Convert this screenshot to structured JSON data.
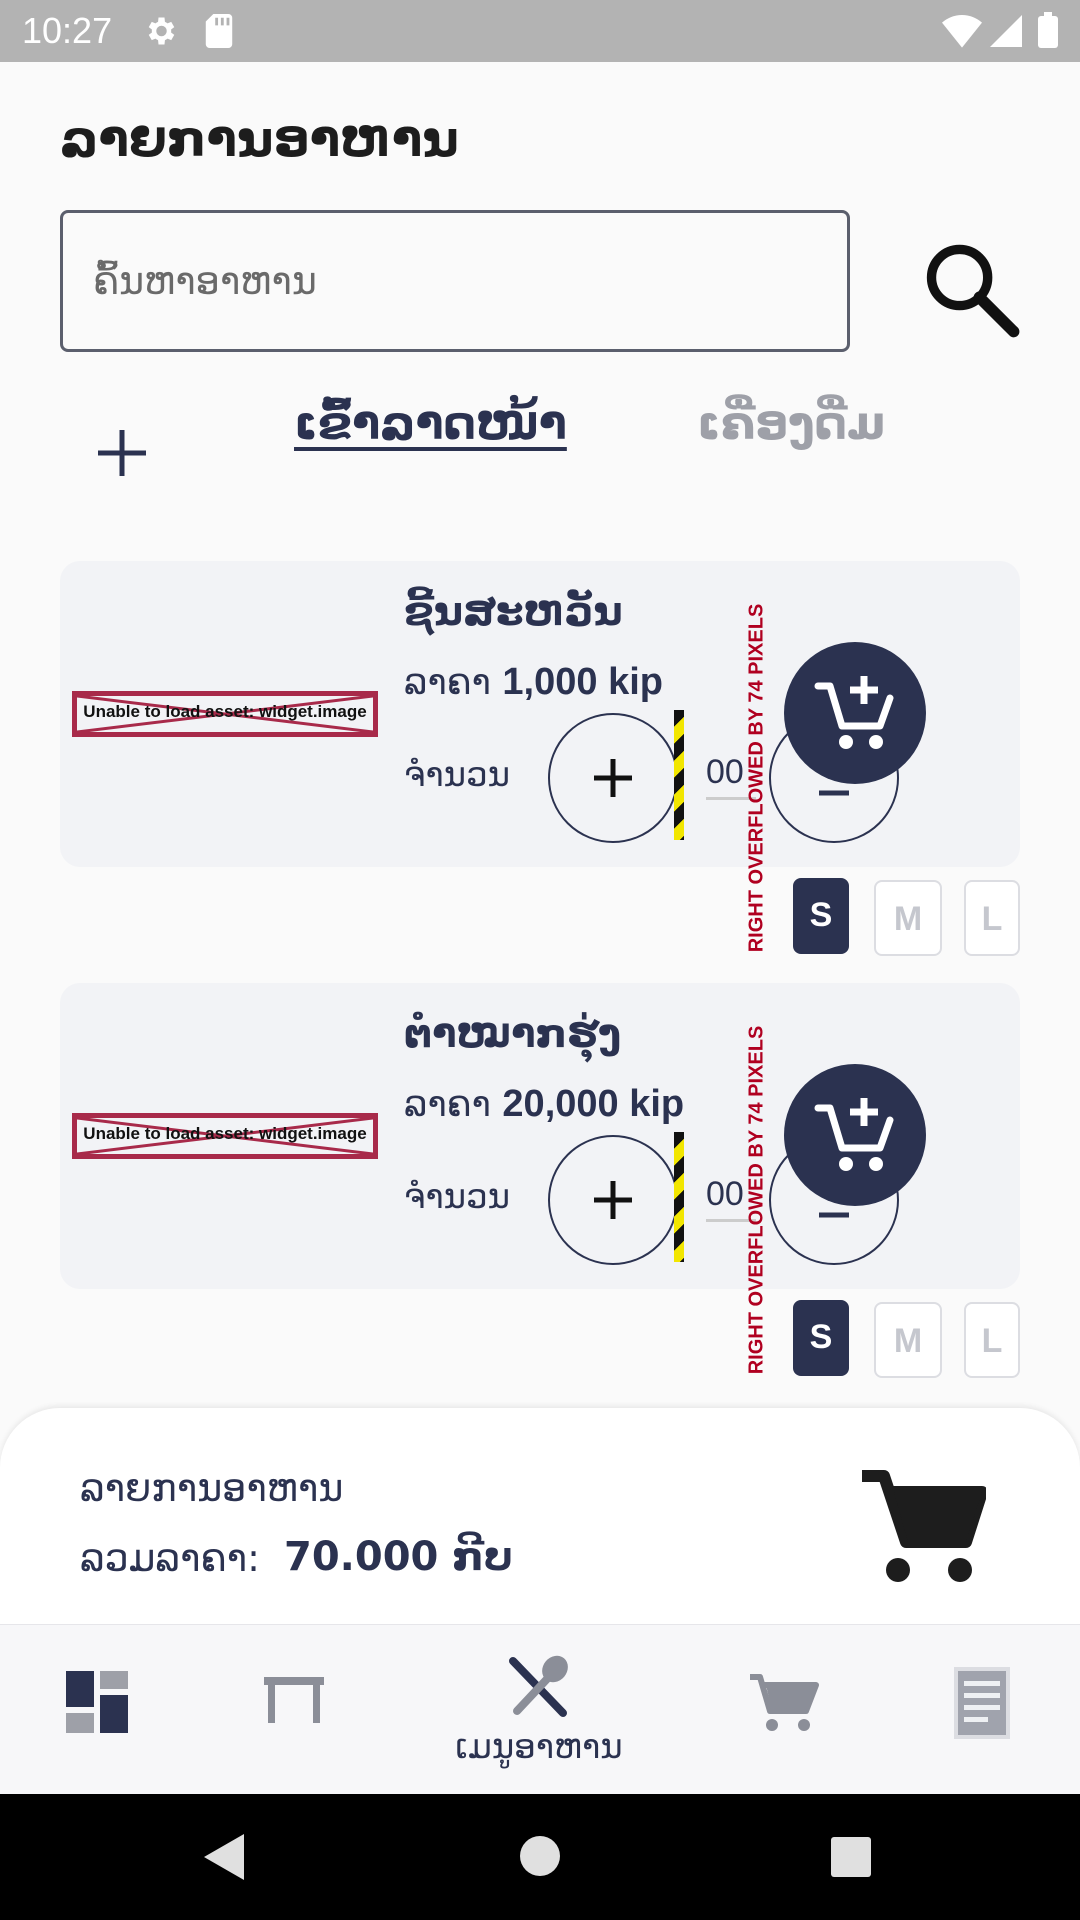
{
  "status_bar": {
    "time": "10:27"
  },
  "header": {
    "title": "ລາຍການອາຫານ"
  },
  "search": {
    "placeholder": "ຄົ້ນຫາອາຫານ"
  },
  "tabs": [
    {
      "label": "ເຂົ້າລາດໜ້າ",
      "active": true
    },
    {
      "label": "ເຄື່ອງດື່ມ",
      "active": false
    }
  ],
  "items": [
    {
      "image_error": "Unable to load asset: widget.image",
      "name": "ຊີ້ນສະຫວັນ",
      "price_label": "ລາຄາ",
      "price_value": "1,000 kip",
      "qty_label": "ຈຳນວນ",
      "qty_value": "00",
      "overflow_text": "RIGHT OVERFLOWED BY 74 PIXELS",
      "sizes": [
        "S",
        "M",
        "L"
      ],
      "selected_size": "S"
    },
    {
      "image_error": "Unable to load asset: widget.image",
      "name": "ຕຳໝາກຮຸ່ງ",
      "price_label": "ລາຄາ",
      "price_value": "20,000 kip",
      "qty_label": "ຈຳນວນ",
      "qty_value": "00",
      "overflow_text": "RIGHT OVERFLOWED BY 74 PIXELS",
      "sizes": [
        "S",
        "M",
        "L"
      ],
      "selected_size": "S"
    }
  ],
  "cart_summary": {
    "title": "ລາຍການອາຫານ",
    "total_label": "ລວມລາຄາ:",
    "total_value": "70.000 ກີບ"
  },
  "bottom_nav": {
    "items": [
      {
        "icon": "dashboard-icon",
        "label": ""
      },
      {
        "icon": "table-icon",
        "label": ""
      },
      {
        "icon": "food-menu-icon",
        "label": "ເມນູອາຫານ",
        "active": true
      },
      {
        "icon": "cart-icon",
        "label": ""
      },
      {
        "icon": "receipt-icon",
        "label": ""
      }
    ]
  },
  "colors": {
    "primary": "#2b3250",
    "background": "#fafafa",
    "card": "#f2f3f6",
    "inactive": "#9ea0a8",
    "error_border": "#a82a4a"
  }
}
